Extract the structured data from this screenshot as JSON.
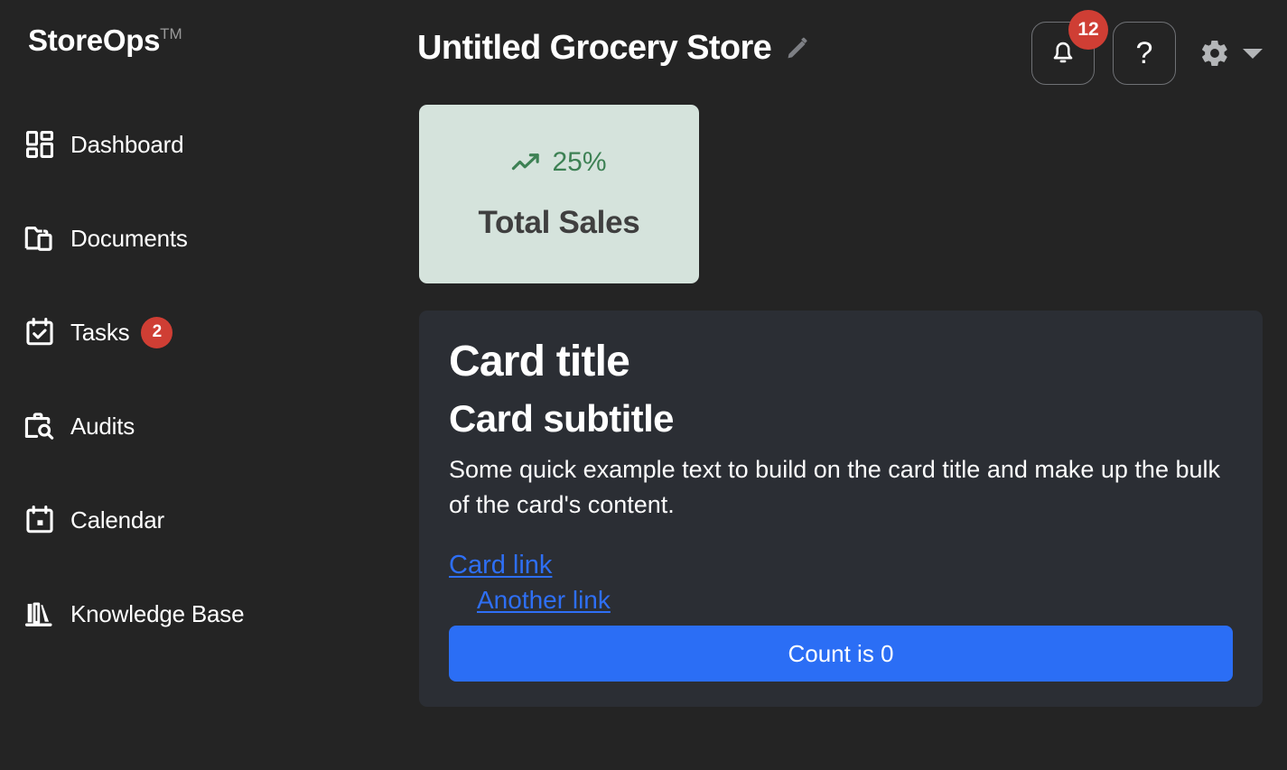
{
  "brand": {
    "name": "StoreOps",
    "tm": "TM"
  },
  "sidebar": {
    "items": [
      {
        "label": "Dashboard",
        "icon": "dashboard-grid-icon",
        "badge": null
      },
      {
        "label": "Documents",
        "icon": "folder-copy-icon",
        "badge": null
      },
      {
        "label": "Tasks",
        "icon": "calendar-check-icon",
        "badge": "2"
      },
      {
        "label": "Audits",
        "icon": "briefcase-search-icon",
        "badge": null
      },
      {
        "label": "Calendar",
        "icon": "calendar-icon",
        "badge": null
      },
      {
        "label": "Knowledge Base",
        "icon": "books-library-icon",
        "badge": null
      }
    ]
  },
  "header": {
    "title": "Untitled Grocery Store",
    "edit_icon": "pencil-edit-icon",
    "notifications": {
      "icon": "bell-icon",
      "badge": "12"
    },
    "help": {
      "icon": "question-mark-icon",
      "label": "?"
    },
    "settings": {
      "icon": "gear-icon",
      "caret": "chevron-down-icon"
    }
  },
  "stat_card": {
    "trend_icon": "trending-up-icon",
    "delta": "25%",
    "label": "Total Sales",
    "bg_color": "#d5e3dc",
    "accent_color": "#3d8154"
  },
  "content_card": {
    "title": "Card title",
    "subtitle": "Card subtitle",
    "body": "Some quick example text to build on the card title and make up the bulk of the card's content.",
    "link_primary": "Card link",
    "link_secondary": "Another link",
    "button_label": "Count is 0",
    "button_color": "#2b6ef5",
    "link_color": "#2e6ff5",
    "bg_color": "#2b2e34"
  },
  "theme": {
    "page_bg": "#242424",
    "badge_red": "#cf3e34",
    "text_primary": "#ffffff",
    "text_muted": "#9a9a9a"
  }
}
